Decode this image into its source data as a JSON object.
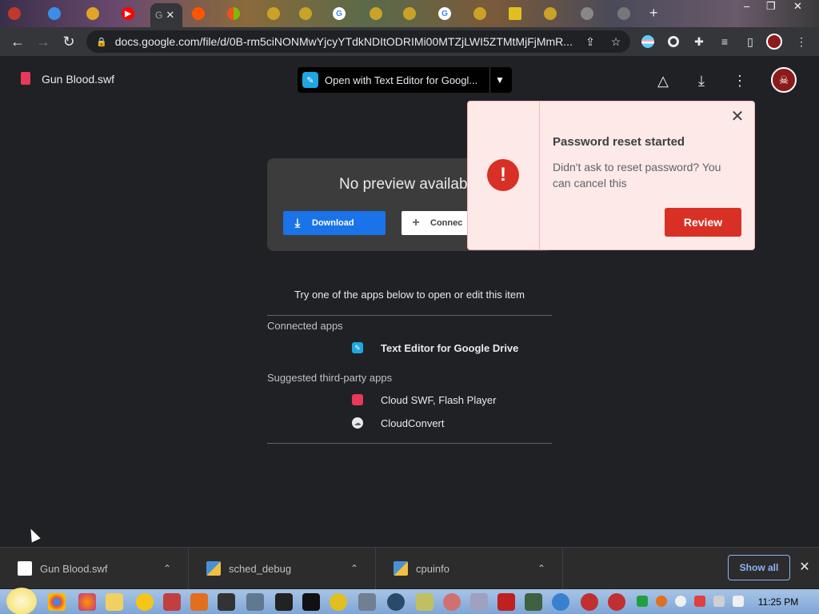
{
  "browser": {
    "active_tab_label": "G",
    "address": "docs.google.com/file/d/0B-rm5ciNONMwYjcyYTdkNDItODRIMi00MTZjLWI5ZTMtMjFjMmR..."
  },
  "drive": {
    "file_name": "Gun Blood.swf",
    "open_with_label": "Open with Text Editor for Googl..."
  },
  "preview": {
    "no_preview_text": "No preview availab",
    "download_label": "Download",
    "connect_label": "Connec"
  },
  "apps": {
    "try_text": "Try one of the apps below to open or edit this item",
    "connected_label": "Connected apps",
    "connected": [
      {
        "name": "Text Editor for Google Drive"
      }
    ],
    "suggested_label": "Suggested third-party apps",
    "suggested": [
      {
        "name": "Cloud SWF, Flash Player"
      },
      {
        "name": "CloudConvert"
      }
    ]
  },
  "popup": {
    "title": "Password reset started",
    "body": "Didn't ask to reset password? You can cancel this",
    "review_label": "Review"
  },
  "shelf": {
    "downloads": [
      {
        "name": "Gun Blood.swf"
      },
      {
        "name": "sched_debug"
      },
      {
        "name": "cpuinfo"
      }
    ],
    "show_all_label": "Show all"
  },
  "taskbar": {
    "clock": "11:25 PM"
  },
  "colors": {
    "accent_blue": "#1a73e8",
    "alert_red": "#d93025",
    "popup_bg": "#fde9e7"
  }
}
